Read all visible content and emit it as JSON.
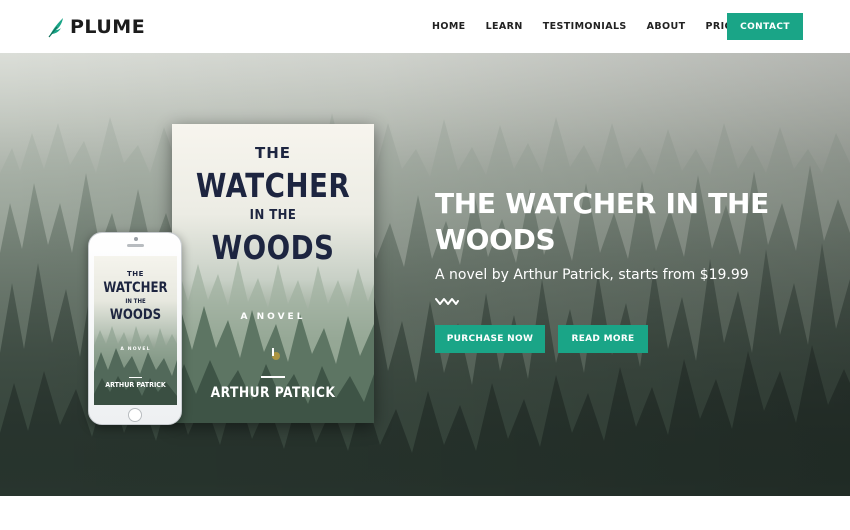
{
  "brand": {
    "name": "PLUME",
    "icon": "feather-icon",
    "accent_color": "#1aa587"
  },
  "nav": {
    "items": [
      "HOME",
      "LEARN",
      "TESTIMONIALS",
      "ABOUT",
      "PRICES"
    ],
    "contact_label": "CONTACT"
  },
  "hero": {
    "title": "THE WATCHER IN THE WOODS",
    "subtitle": "A novel by Arthur Patrick, starts from $19.99",
    "divider_icon": "zigzag-icon",
    "purchase_label": "PURCHASE NOW",
    "read_more_label": "READ MORE"
  },
  "book_cover": {
    "line1": "THE",
    "line2": "WATCHER",
    "line3": "IN THE",
    "line4": "WOODS",
    "tagline": "A NOVEL",
    "author": "ARTHUR PATRICK"
  },
  "phone_cover": {
    "line1": "THE",
    "line2": "WATCHER",
    "line3": "IN THE",
    "line4": "WOODS",
    "tagline": "A NOVEL",
    "author": "ARTHUR PATRICK"
  }
}
